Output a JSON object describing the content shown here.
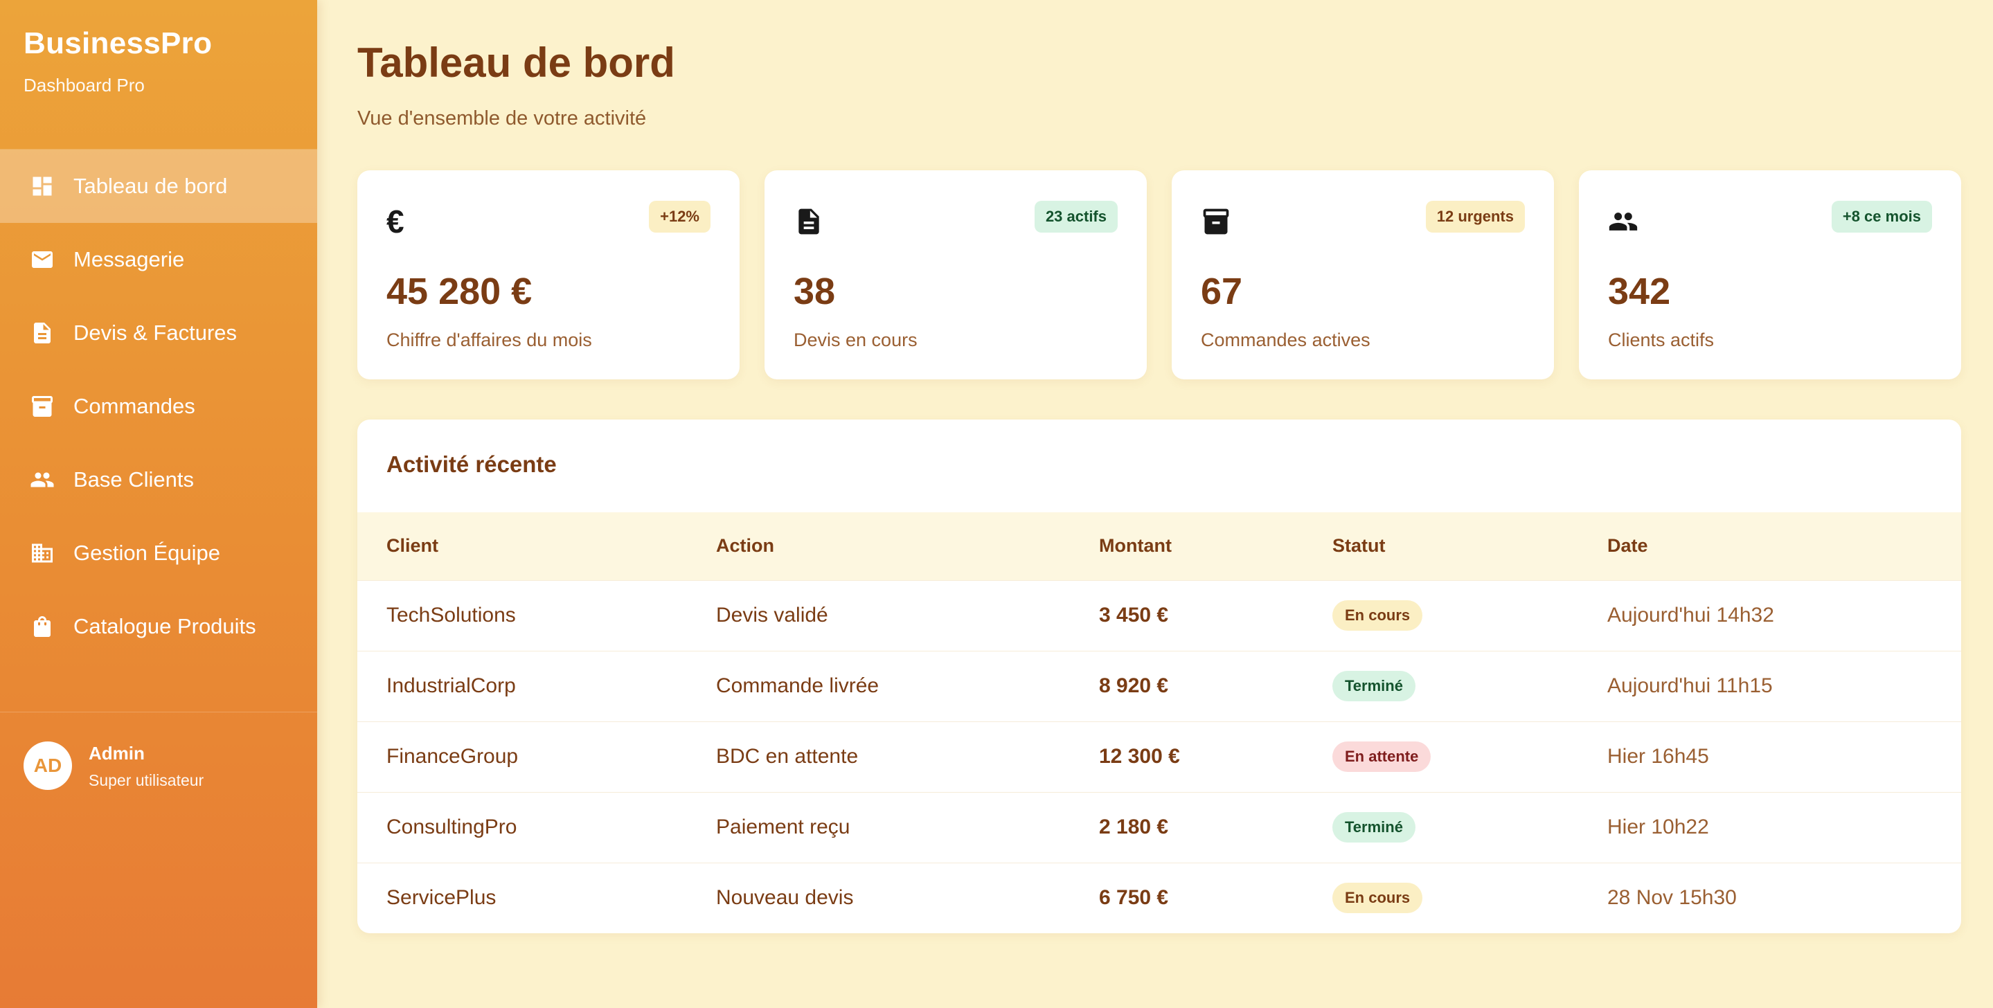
{
  "sidebar": {
    "brand_name": "BusinessPro",
    "brand_subtitle": "Dashboard Pro",
    "items": [
      {
        "label": "Tableau de bord",
        "icon": "dashboard-icon",
        "active": true
      },
      {
        "label": "Messagerie",
        "icon": "mail-icon"
      },
      {
        "label": "Devis & Factures",
        "icon": "document-icon"
      },
      {
        "label": "Commandes",
        "icon": "archive-icon"
      },
      {
        "label": "Base Clients",
        "icon": "people-icon"
      },
      {
        "label": "Gestion Équipe",
        "icon": "building-icon"
      },
      {
        "label": "Catalogue Produits",
        "icon": "shopping-bag-icon"
      }
    ],
    "user": {
      "initials": "AD",
      "name": "Admin",
      "role": "Super utilisateur"
    }
  },
  "header": {
    "title": "Tableau de bord",
    "subtitle": "Vue d'ensemble de votre activité"
  },
  "stats": [
    {
      "icon": "euro-icon",
      "badge": "+12%",
      "value": "45 280 €",
      "label": "Chiffre d'affaires du mois"
    },
    {
      "icon": "document-icon",
      "badge": "23 actifs",
      "value": "38",
      "label": "Devis en cours"
    },
    {
      "icon": "archive-icon",
      "badge": "12 urgents",
      "value": "67",
      "label": "Commandes actives"
    },
    {
      "icon": "people-icon",
      "badge": "+8 ce mois",
      "value": "342",
      "label": "Clients actifs"
    }
  ],
  "activity": {
    "title": "Activité récente",
    "columns": [
      "Client",
      "Action",
      "Montant",
      "Statut",
      "Date"
    ],
    "rows": [
      {
        "client": "TechSolutions",
        "action": "Devis validé",
        "amount": "3 450 €",
        "status": "En cours",
        "date": "Aujourd'hui 14h32"
      },
      {
        "client": "IndustrialCorp",
        "action": "Commande livrée",
        "amount": "8 920 €",
        "status": "Terminé",
        "date": "Aujourd'hui 11h15"
      },
      {
        "client": "FinanceGroup",
        "action": "BDC en attente",
        "amount": "12 300 €",
        "status": "En attente",
        "date": "Hier 16h45"
      },
      {
        "client": "ConsultingPro",
        "action": "Paiement reçu",
        "amount": "2 180 €",
        "status": "Terminé",
        "date": "Hier 10h22"
      },
      {
        "client": "ServicePlus",
        "action": "Nouveau devis",
        "amount": "6 750 €",
        "status": "En cours",
        "date": "28 Nov 15h30"
      }
    ]
  },
  "colors": {
    "sidebar_top": "#eca43a",
    "sidebar_bottom": "#e77b35",
    "background": "#fcf2cc",
    "text_brown": "#7a3c14",
    "badge_yellow": "#fbefc4",
    "badge_green": "#d8f3e3",
    "badge_red": "#fbdada"
  }
}
